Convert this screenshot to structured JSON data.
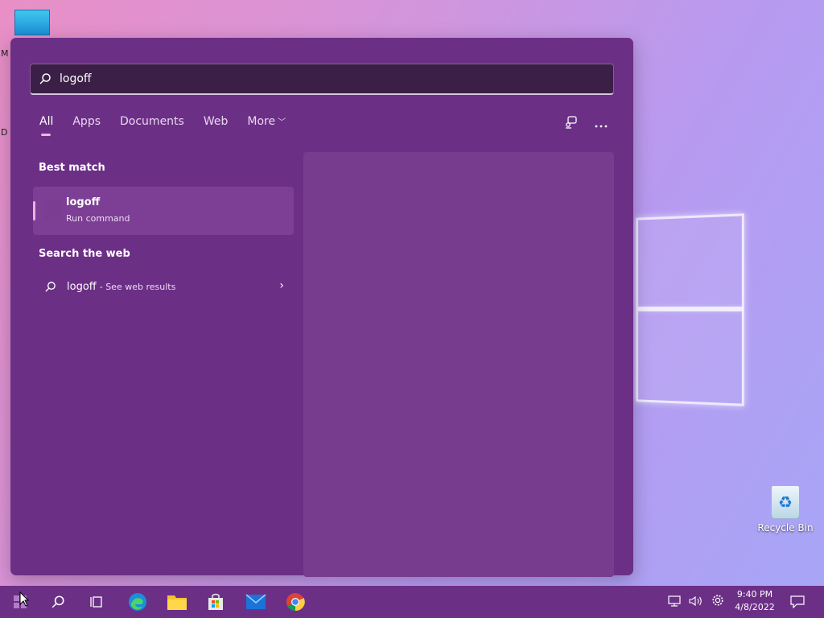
{
  "desktop": {
    "left_letters": [
      "M",
      "D"
    ],
    "recycle_bin_label": "Recycle Bin"
  },
  "search": {
    "query": "logoff",
    "tabs": [
      {
        "label": "All",
        "active": true
      },
      {
        "label": "Apps",
        "active": false
      },
      {
        "label": "Documents",
        "active": false
      },
      {
        "label": "Web",
        "active": false
      },
      {
        "label": "More",
        "active": false
      }
    ],
    "more_menu_icon": "ellipsis-icon",
    "share_icon": "connect-icon"
  },
  "best_match": {
    "title": "Best match",
    "item": {
      "name": "logoff",
      "type": "Run command"
    }
  },
  "web_search": {
    "title": "Search the web",
    "query": "logoff",
    "suffix": "- See web results"
  },
  "taskbar": {
    "apps": [
      "start-icon",
      "search-icon",
      "task-view-icon",
      "edge-icon",
      "file-explorer-icon",
      "store-icon",
      "mail-icon",
      "chrome-icon"
    ],
    "time": "9:40 PM",
    "date": "4/8/2022"
  },
  "colors": {
    "panel": "#6c2f86",
    "taskbar": "#6c2f86",
    "accent": "#f2b3e4"
  }
}
